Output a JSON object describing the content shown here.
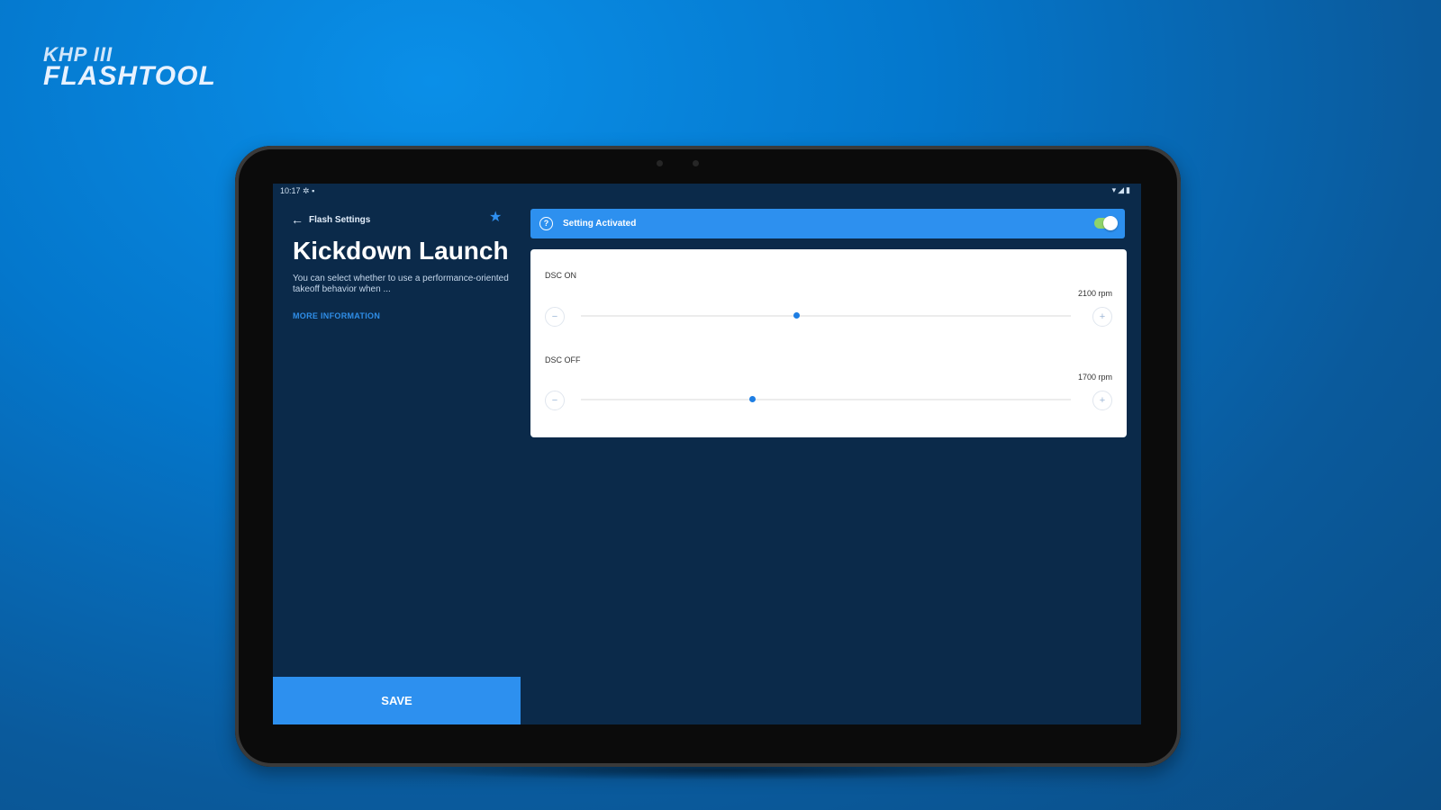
{
  "brand": {
    "logo_top": "KHP III",
    "logo_main": "FLASHTOOL"
  },
  "statusbar": {
    "time": "10:17",
    "left_icons": "✲ ▪",
    "right_icons": "▾◢▮"
  },
  "nav": {
    "back_label": "Flash Settings"
  },
  "page": {
    "title": "Kickdown Launch",
    "description": "You can select whether to use a performance-oriented takeoff behavior when ...",
    "more_link": "MORE INFORMATION",
    "save_label": "SAVE"
  },
  "activation": {
    "label": "Setting Activated",
    "enabled": true
  },
  "settings": [
    {
      "label": "DSC ON",
      "value": "2100 rpm",
      "level": 0.44
    },
    {
      "label": "DSC OFF",
      "value": "1700 rpm",
      "level": 0.35
    }
  ],
  "colors": {
    "accent": "#2d90ef",
    "screen_bg": "#0b2a4a",
    "toggle_on": "#8fd36a"
  }
}
